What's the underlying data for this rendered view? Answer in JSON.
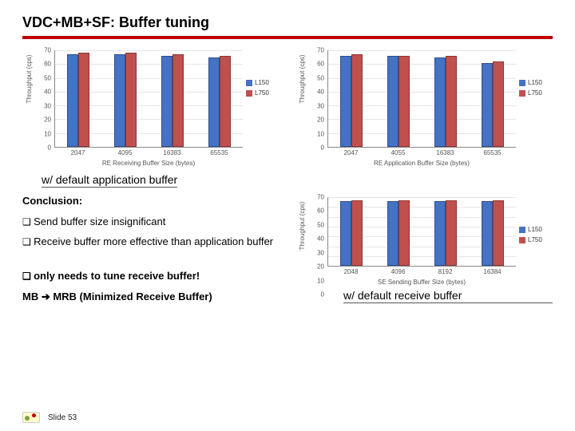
{
  "title": "VDC+MB+SF: Buffer tuning",
  "caption_left": "w/ default application buffer",
  "caption_right": "w/ default receive buffer",
  "conclusion_heading": "Conclusion:",
  "bullets": {
    "b1": "Send buffer size insignificant",
    "b2": "Receive buffer more effective than application buffer",
    "b3": "only needs to tune receive buffer!"
  },
  "mb_line": "MB ➔ MRB (Minimized Receive Buffer)",
  "footer": {
    "slide": "Slide 53"
  },
  "chart_data": [
    {
      "type": "bar",
      "title": "",
      "xlabel": "RE Receiving Buffer Size (bytes)",
      "ylabel": "Throughput (cps)",
      "categories": [
        "2047",
        "4095",
        "16383",
        "65535"
      ],
      "ylim": [
        0,
        70
      ],
      "yticks": [
        0,
        10,
        20,
        30,
        40,
        50,
        60,
        70
      ],
      "series": [
        {
          "name": "L150",
          "color": "#4472c4",
          "values": [
            67,
            67,
            66,
            65
          ]
        },
        {
          "name": "L750",
          "color": "#c0504d",
          "values": [
            68,
            68,
            67,
            66
          ]
        }
      ]
    },
    {
      "type": "bar",
      "title": "",
      "xlabel": "RE Application Buffer Size (bytes)",
      "ylabel": "Throughput (cps)",
      "categories": [
        "2047",
        "4055",
        "16383",
        "65535"
      ],
      "ylim": [
        0,
        70
      ],
      "yticks": [
        0,
        10,
        20,
        30,
        40,
        50,
        60,
        70
      ],
      "series": [
        {
          "name": "L150",
          "color": "#4472c4",
          "values": [
            66,
            66,
            65,
            61
          ]
        },
        {
          "name": "L750",
          "color": "#c0504d",
          "values": [
            67,
            66,
            66,
            62
          ]
        }
      ]
    },
    {
      "type": "bar",
      "title": "",
      "xlabel": "SE Sending Buffer Size (bytes)",
      "ylabel": "Throughput (cps)",
      "categories": [
        "2048",
        "4096",
        "8192",
        "16384"
      ],
      "ylim": [
        0,
        70
      ],
      "yticks": [
        0,
        10,
        20,
        30,
        40,
        50,
        60,
        70
      ],
      "series": [
        {
          "name": "L150",
          "color": "#4472c4",
          "values": [
            66,
            66,
            66,
            66
          ]
        },
        {
          "name": "L750",
          "color": "#c0504d",
          "values": [
            67,
            67,
            67,
            67
          ]
        }
      ]
    }
  ]
}
